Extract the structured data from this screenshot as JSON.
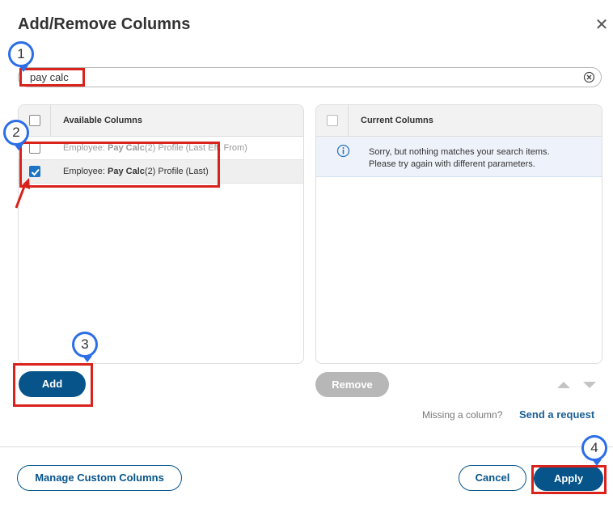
{
  "dialog": {
    "title": "Add/Remove Columns",
    "close_icon": "close-icon"
  },
  "search": {
    "value": "pay calc",
    "clear_icon": "clear-circle-icon"
  },
  "available": {
    "header": "Available Columns",
    "rows": [
      {
        "prefix": "Employee: ",
        "bold": "Pay Calc",
        "suffix": "(2) Profile (Last Eff. From)",
        "checked": false
      },
      {
        "prefix": "Employee: ",
        "bold": "Pay Calc",
        "suffix": "(2) Profile (Last)",
        "checked": true
      }
    ]
  },
  "current": {
    "header": "Current Columns",
    "empty_line1": "Sorry, but nothing matches your search items.",
    "empty_line2": "Please try again with different parameters.",
    "info_icon": "info-icon"
  },
  "actions": {
    "add_label": "Add",
    "remove_label": "Remove",
    "missing_text": "Missing a column?",
    "send_request": "Send a request"
  },
  "footer": {
    "manage_label": "Manage Custom Columns",
    "cancel_label": "Cancel",
    "apply_label": "Apply"
  },
  "annotations": {
    "step1": "1",
    "step2": "2",
    "step3": "3",
    "step4": "4"
  },
  "colors": {
    "primary": "#06548a",
    "link": "#1b5f95",
    "disabled": "#b7b7b7",
    "highlight": "#d9221c",
    "badge_border": "#2b6ee8",
    "checkbox_checked": "#1d74c4"
  }
}
